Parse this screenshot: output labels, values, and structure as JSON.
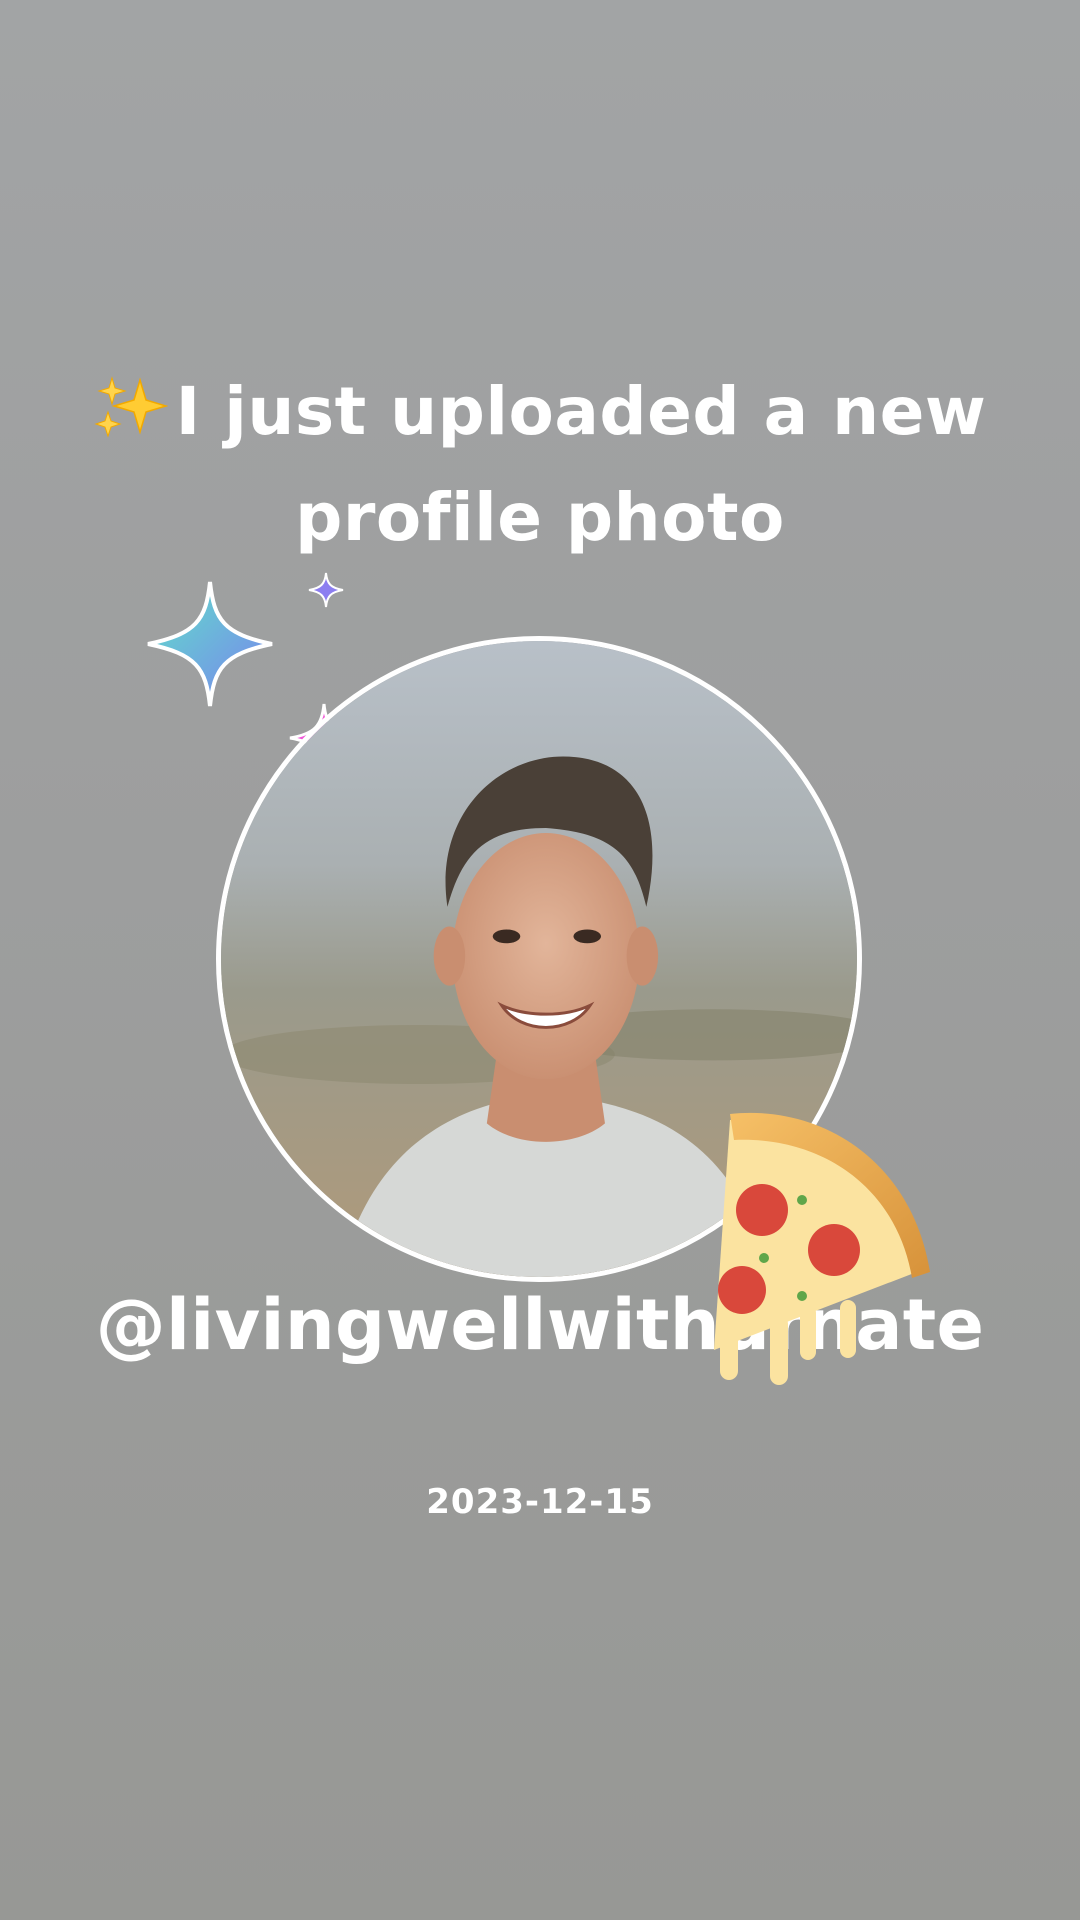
{
  "story": {
    "headline_line1": "I just uploaded a new",
    "headline_line2": "profile photo",
    "username": "@livingwellwithdrnate",
    "date": "2023-12-15"
  },
  "icons": {
    "headline_emoji": "sparkles-emoji",
    "decor": [
      "teal-sparkle-icon",
      "purple-sparkle-icon",
      "pink-sparkle-icon",
      "pizza-sticker-icon"
    ]
  },
  "colors": {
    "background": "#9d9e9e",
    "text": "#ffffff",
    "ring": "#ffffff"
  }
}
